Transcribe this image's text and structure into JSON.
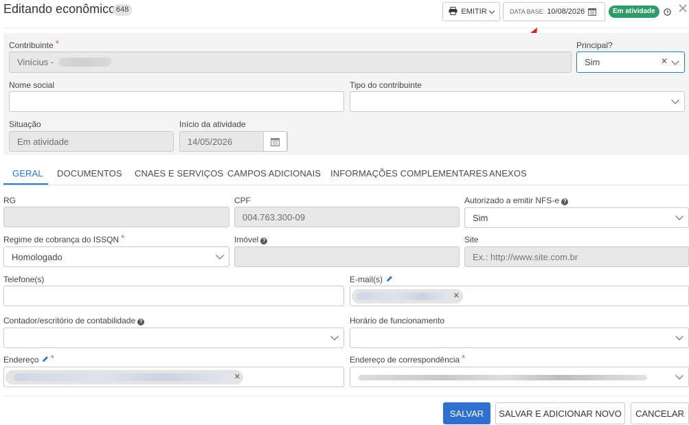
{
  "header": {
    "title": "Editando econômico",
    "id_badge": "648",
    "emitir_label": "EMITIR",
    "data_base_label": "DATA BASE:",
    "data_base_value": "10/08/2026",
    "status_badge": "Em atividade"
  },
  "top": {
    "contribuinte_label": "Contribuinte",
    "contribuinte_value": "Vinícius -",
    "principal_label": "Principal?",
    "principal_value": "Sim",
    "nome_social_label": "Nome social",
    "tipo_label": "Tipo do contribuinte",
    "situacao_label": "Situação",
    "situacao_value": "Em atividade",
    "inicio_label": "Início da atividade",
    "inicio_value": "14/05/2026"
  },
  "tabs": [
    {
      "label": "GERAL"
    },
    {
      "label": "DOCUMENTOS"
    },
    {
      "label": "CNAES E SERVIÇOS"
    },
    {
      "label": "CAMPOS ADICIONAIS"
    },
    {
      "label": "INFORMAÇÕES COMPLEMENTARES"
    },
    {
      "label": "ANEXOS"
    }
  ],
  "geral": {
    "rg_label": "RG",
    "cpf_label": "CPF",
    "cpf_value": "004.763.300-09",
    "nfse_label": "Autorizado a emitir NFS-e",
    "nfse_value": "Sim",
    "regime_label": "Regime de cobrança do ISSQN",
    "regime_value": "Homologado",
    "imovel_label": "Imóvel",
    "site_label": "Site",
    "site_placeholder": "Ex.: http://www.site.com.br",
    "telefone_label": "Telefone(s)",
    "email_label": "E-mail(s)",
    "contador_label": "Contador/escritório de contabilidade",
    "horario_label": "Horário de funcionamento",
    "endereco_label": "Endereço",
    "correspondencia_label": "Endereço de correspondência"
  },
  "footer": {
    "salvar": "SALVAR",
    "salvar_novo": "SALVAR E ADICIONAR NOVO",
    "cancelar": "CANCELAR"
  },
  "colors": {
    "accent": "#2979c8",
    "primary_button": "#2f6fcf",
    "status_badge": "#2e9b6a",
    "required": "#e0503a",
    "annotation_arrow": "#e02020"
  }
}
